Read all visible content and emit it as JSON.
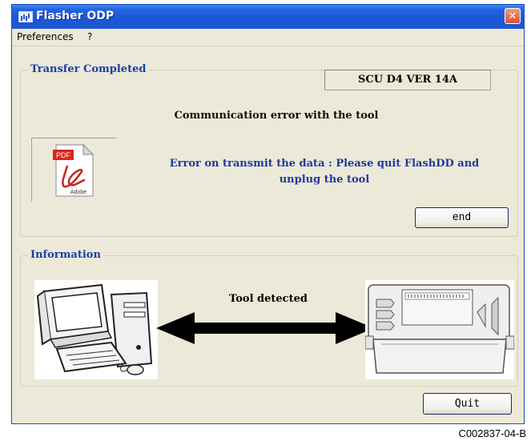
{
  "window": {
    "title": "Flasher ODP",
    "close_glyph": "✕"
  },
  "menu": {
    "preferences": "Preferences",
    "help": "?"
  },
  "transfer": {
    "group_title": "Transfer Completed",
    "version": "SCU D4 VER  14A",
    "comm_error": "Communication error with the tool",
    "error_line1": "Error on transmit the data : Please quit FlashDD and",
    "error_line2": "unplug the tool",
    "end_button": "end"
  },
  "pdf_icon": {
    "icon": "pdf-document-icon",
    "badge": "PDF",
    "brand": "Adobe"
  },
  "information": {
    "group_title": "Information",
    "status": "Tool detected",
    "computer_icon": "computer-icon",
    "tool_icon": "tool-device-icon",
    "arrow_icon": "double-arrow-icon"
  },
  "quit_button": "Quit",
  "caption": "C002837-04-B",
  "colors": {
    "titlebar": "#2463de",
    "window_bg": "#ece9d8",
    "group_title": "#1a3fa7",
    "error_text": "#1e3aa0",
    "close_button": "#d9532f"
  }
}
